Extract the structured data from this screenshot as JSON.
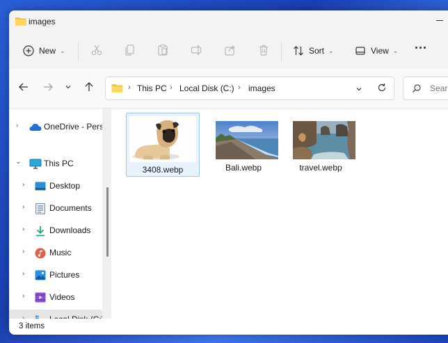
{
  "window": {
    "title": "images"
  },
  "toolbar": {
    "new_label": "New",
    "sort_label": "Sort",
    "view_label": "View",
    "disabled_icons": [
      "cut-icon",
      "copy-icon",
      "paste-icon",
      "rename-icon",
      "share-icon",
      "delete-icon"
    ],
    "more_icon": "more-options-icon"
  },
  "address": {
    "crumbs": [
      "This PC",
      "Local Disk (C:)",
      "images"
    ]
  },
  "search": {
    "placeholder": "Search images"
  },
  "sidebar": {
    "items": [
      {
        "label": "OneDrive - Personal",
        "icon": "cloud-icon"
      },
      {
        "label": "This PC",
        "icon": "monitor-icon"
      },
      {
        "label": "Desktop",
        "icon": "desktop-icon"
      },
      {
        "label": "Documents",
        "icon": "documents-icon"
      },
      {
        "label": "Downloads",
        "icon": "download-icon"
      },
      {
        "label": "Music",
        "icon": "music-icon"
      },
      {
        "label": "Pictures",
        "icon": "pictures-icon"
      },
      {
        "label": "Videos",
        "icon": "videos-icon"
      },
      {
        "label": "Local Disk (C:)",
        "icon": "drive-icon"
      }
    ]
  },
  "files": [
    {
      "name": "3408.webp",
      "thumbnail": "pug-dog-thumbnail"
    },
    {
      "name": "Bali.webp",
      "thumbnail": "beach-thumbnail"
    },
    {
      "name": "travel.webp",
      "thumbnail": "coast-rocks-thumbnail"
    }
  ],
  "status": {
    "count_text": "3 items"
  },
  "colors": {
    "accent": "#0067c0",
    "folder": "#f5c342",
    "selection": "#e8f2fc"
  }
}
